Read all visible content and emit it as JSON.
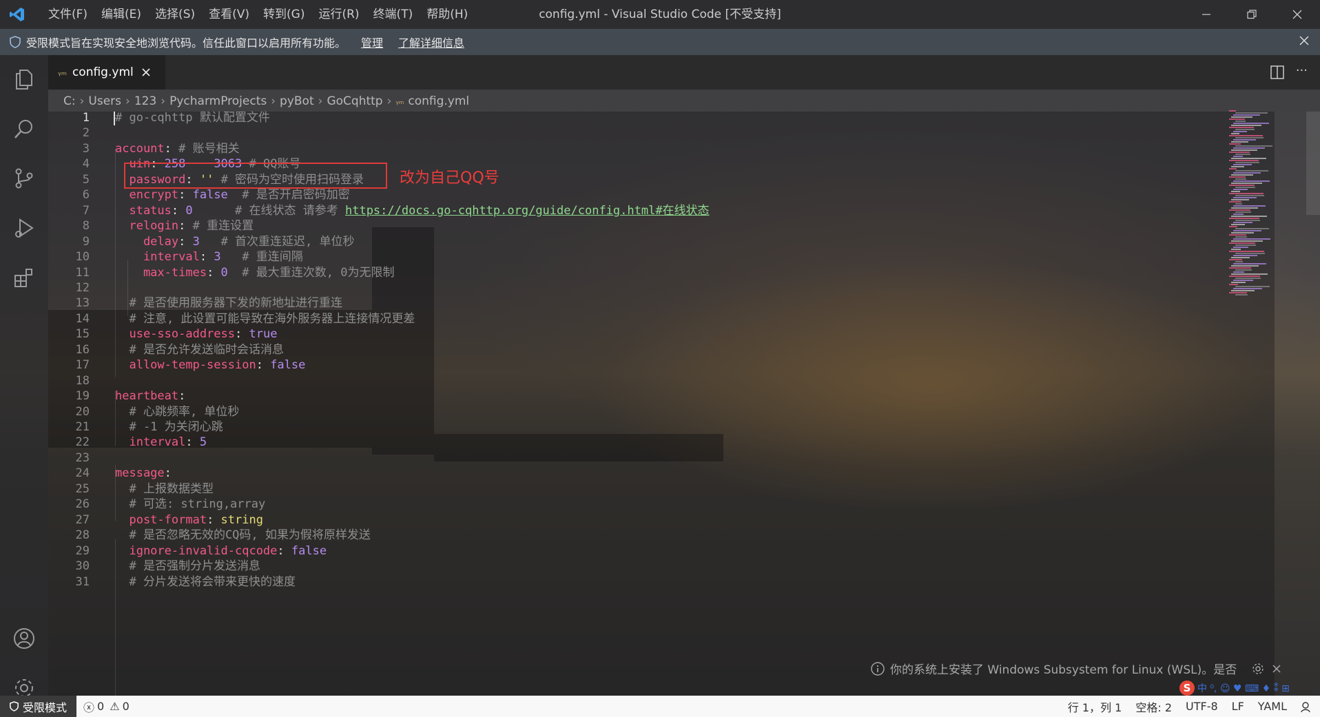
{
  "window": {
    "title": "config.yml - Visual Studio Code [不受支持]",
    "menu": [
      "文件(F)",
      "编辑(E)",
      "选择(S)",
      "查看(V)",
      "转到(G)",
      "运行(R)",
      "终端(T)",
      "帮助(H)"
    ]
  },
  "banner": {
    "text": "受限模式旨在实现安全地浏览代码。信任此窗口以启用所有功能。",
    "manage": "管理",
    "learn_more": "了解详细信息"
  },
  "tab": {
    "label": "config.yml"
  },
  "breadcrumb": [
    "C:",
    "Users",
    "123",
    "PycharmProjects",
    "pyBot",
    "GoCqhttp",
    "config.yml"
  ],
  "annotation": "改为自己QQ号",
  "editor": {
    "lines": [
      {
        "n": "1",
        "parts": [
          {
            "t": "# go-cqhttp 默认配置文件",
            "c": "c"
          }
        ]
      },
      {
        "n": "2",
        "parts": []
      },
      {
        "n": "3",
        "parts": [
          {
            "t": "account",
            "c": "k"
          },
          {
            "t": ": ",
            "c": "p"
          },
          {
            "t": "# 账号相关",
            "c": "c"
          }
        ]
      },
      {
        "n": "4",
        "parts": [
          {
            "t": "  uin",
            "c": "k"
          },
          {
            "t": ": ",
            "c": "p"
          },
          {
            "t": "258    3063",
            "c": "v"
          },
          {
            "t": " # QQ账号",
            "c": "c"
          }
        ]
      },
      {
        "n": "5",
        "parts": [
          {
            "t": "  password",
            "c": "k"
          },
          {
            "t": ": ",
            "c": "p"
          },
          {
            "t": "''",
            "c": "s"
          },
          {
            "t": " # 密码为空时使用扫码登录",
            "c": "c"
          }
        ]
      },
      {
        "n": "6",
        "parts": [
          {
            "t": "  encrypt",
            "c": "k"
          },
          {
            "t": ": ",
            "c": "p"
          },
          {
            "t": "false",
            "c": "v"
          },
          {
            "t": "  # 是否开启密码加密",
            "c": "c"
          }
        ]
      },
      {
        "n": "7",
        "parts": [
          {
            "t": "  status",
            "c": "k"
          },
          {
            "t": ": ",
            "c": "p"
          },
          {
            "t": "0",
            "c": "v"
          },
          {
            "t": "      # 在线状态 请参考 ",
            "c": "c"
          },
          {
            "t": "https://docs.go-cqhttp.org/guide/config.html#在线状态",
            "c": "url"
          }
        ]
      },
      {
        "n": "8",
        "parts": [
          {
            "t": "  relogin",
            "c": "k"
          },
          {
            "t": ": ",
            "c": "p"
          },
          {
            "t": "# 重连设置",
            "c": "c"
          }
        ]
      },
      {
        "n": "9",
        "parts": [
          {
            "t": "    delay",
            "c": "k"
          },
          {
            "t": ": ",
            "c": "p"
          },
          {
            "t": "3",
            "c": "v"
          },
          {
            "t": "   # 首次重连延迟, 单位秒",
            "c": "c"
          }
        ]
      },
      {
        "n": "10",
        "parts": [
          {
            "t": "    interval",
            "c": "k"
          },
          {
            "t": ": ",
            "c": "p"
          },
          {
            "t": "3",
            "c": "v"
          },
          {
            "t": "   # 重连间隔",
            "c": "c"
          }
        ]
      },
      {
        "n": "11",
        "parts": [
          {
            "t": "    max-times",
            "c": "k"
          },
          {
            "t": ": ",
            "c": "p"
          },
          {
            "t": "0",
            "c": "v"
          },
          {
            "t": "  # 最大重连次数, 0为无限制",
            "c": "c"
          }
        ]
      },
      {
        "n": "12",
        "parts": []
      },
      {
        "n": "13",
        "parts": [
          {
            "t": "  # 是否使用服务器下发的新地址进行重连",
            "c": "c"
          }
        ]
      },
      {
        "n": "14",
        "parts": [
          {
            "t": "  # 注意, 此设置可能导致在海外服务器上连接情况更差",
            "c": "c"
          }
        ]
      },
      {
        "n": "15",
        "parts": [
          {
            "t": "  use-sso-address",
            "c": "k"
          },
          {
            "t": ": ",
            "c": "p"
          },
          {
            "t": "true",
            "c": "v"
          }
        ]
      },
      {
        "n": "16",
        "parts": [
          {
            "t": "  # 是否允许发送临时会话消息",
            "c": "c"
          }
        ]
      },
      {
        "n": "17",
        "parts": [
          {
            "t": "  allow-temp-session",
            "c": "k"
          },
          {
            "t": ": ",
            "c": "p"
          },
          {
            "t": "false",
            "c": "v"
          }
        ]
      },
      {
        "n": "18",
        "parts": []
      },
      {
        "n": "19",
        "parts": [
          {
            "t": "heartbeat",
            "c": "k"
          },
          {
            "t": ":",
            "c": "p"
          }
        ]
      },
      {
        "n": "20",
        "parts": [
          {
            "t": "  # 心跳频率, 单位秒",
            "c": "c"
          }
        ]
      },
      {
        "n": "21",
        "parts": [
          {
            "t": "  # -1 为关闭心跳",
            "c": "c"
          }
        ]
      },
      {
        "n": "22",
        "parts": [
          {
            "t": "  interval",
            "c": "k"
          },
          {
            "t": ": ",
            "c": "p"
          },
          {
            "t": "5",
            "c": "v"
          }
        ]
      },
      {
        "n": "23",
        "parts": []
      },
      {
        "n": "24",
        "parts": [
          {
            "t": "message",
            "c": "k"
          },
          {
            "t": ":",
            "c": "p"
          }
        ]
      },
      {
        "n": "25",
        "parts": [
          {
            "t": "  # 上报数据类型",
            "c": "c"
          }
        ]
      },
      {
        "n": "26",
        "parts": [
          {
            "t": "  # 可选: string,array",
            "c": "c"
          }
        ]
      },
      {
        "n": "27",
        "parts": [
          {
            "t": "  post-format",
            "c": "k"
          },
          {
            "t": ": ",
            "c": "p"
          },
          {
            "t": "string",
            "c": "s"
          }
        ]
      },
      {
        "n": "28",
        "parts": [
          {
            "t": "  # 是否忽略无效的CQ码, 如果为假将原样发送",
            "c": "c"
          }
        ]
      },
      {
        "n": "29",
        "parts": [
          {
            "t": "  ignore-invalid-cqcode",
            "c": "k"
          },
          {
            "t": ": ",
            "c": "p"
          },
          {
            "t": "false",
            "c": "v"
          }
        ]
      },
      {
        "n": "30",
        "parts": [
          {
            "t": "  # 是否强制分片发送消息",
            "c": "c"
          }
        ]
      },
      {
        "n": "31",
        "parts": [
          {
            "t": "  # 分片发送将会带来更快的速度",
            "c": "c"
          }
        ]
      }
    ]
  },
  "notification": {
    "text": "你的系统上安装了 Windows Subsystem for Linux (WSL)。是否"
  },
  "statusbar": {
    "restricted": "受限模式",
    "errors": "0",
    "warnings": "0",
    "position": "行 1，列 1",
    "spaces": "空格: 2",
    "encoding": "UTF-8",
    "eol": "LF",
    "language": "YAML"
  },
  "colors": {
    "key": "#f25a8a",
    "comment": "#8f8f8f",
    "value": "#b58cf0",
    "annotation_red": "#e03a3a"
  }
}
